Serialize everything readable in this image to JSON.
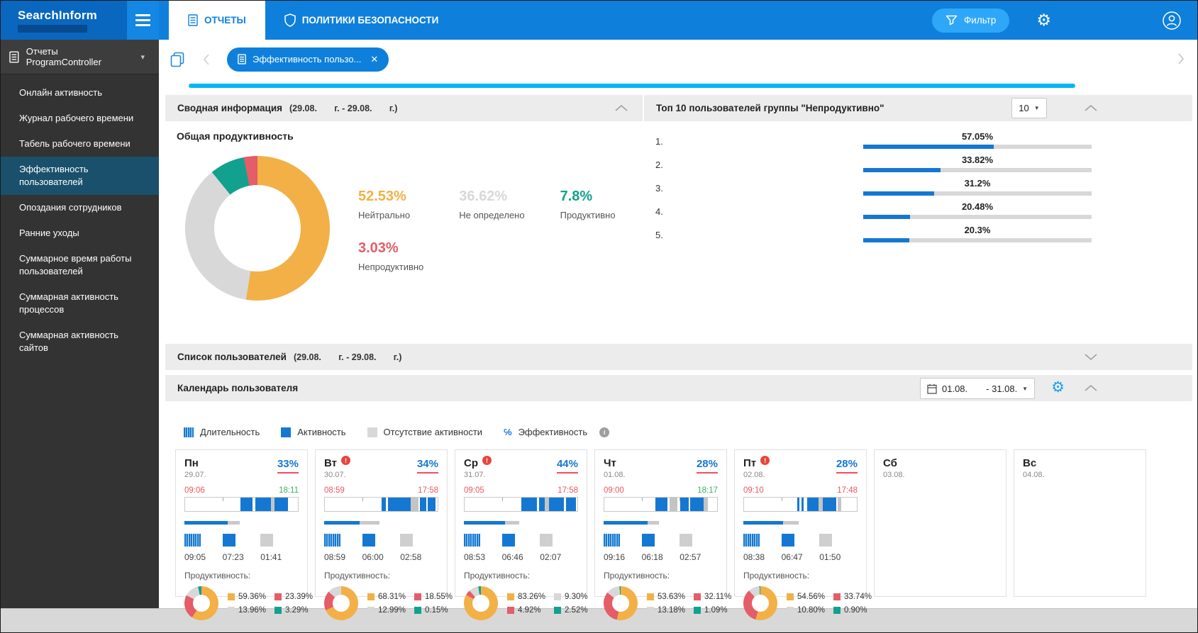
{
  "colors": {
    "orange": "#F2B046",
    "red": "#E45D68",
    "gray": "#D8D8D8",
    "teal": "#13A18F",
    "blue": "#1478D2",
    "accent": "#0E80DB",
    "cyan": "#05B6F5",
    "green": "#3FAE68",
    "time_red": "#EA5860"
  },
  "topbar": {
    "brand": "SearchInform",
    "tabs": [
      {
        "label": "ОТЧЕТЫ",
        "active": true
      },
      {
        "label": "ПОЛИТИКИ БЕЗОПАСНОСТИ",
        "active": false
      }
    ],
    "filter_label": "Фильтр"
  },
  "sidebar": {
    "header_label": "Отчеты ProgramController",
    "items": [
      {
        "label": "Онлайн активность",
        "active": false
      },
      {
        "label": "Журнал рабочего времени",
        "active": false
      },
      {
        "label": "Табель рабочего времени",
        "active": false
      },
      {
        "label": "Эффективность пользователей",
        "active": true
      },
      {
        "label": "Опоздания сотрудников",
        "active": false
      },
      {
        "label": "Ранние уходы",
        "active": false
      },
      {
        "label": "Суммарное время работы пользователей",
        "active": false
      },
      {
        "label": "Суммарная активность процессов",
        "active": false
      },
      {
        "label": "Суммарная активность сайтов",
        "active": false
      }
    ]
  },
  "tabstrip": {
    "chip_label": "Эффективность пользо..."
  },
  "summary": {
    "title": "Сводная информация",
    "period": "(29.08.       г. - 29.08.       г.)",
    "chart_title": "Общая продуктивность",
    "stats": [
      {
        "value": "52.53%",
        "label": "Нейтрально",
        "color": "orange"
      },
      {
        "value": "36.62%",
        "label": "Не определено",
        "color": "gray"
      },
      {
        "value": "7.8%",
        "label": "Продуктивно",
        "color": "teal"
      },
      {
        "value": "3.03%",
        "label": "Непродуктивно",
        "color": "red"
      }
    ]
  },
  "top10": {
    "title": "Топ 10 пользователей группы \"Непродуктивно\"",
    "page_size": "10",
    "rows": [
      {
        "index": "1.",
        "name": "",
        "value": "57.05%",
        "pct": 57.05
      },
      {
        "index": "2.",
        "name": "",
        "value": "33.82%",
        "pct": 33.82
      },
      {
        "index": "3.",
        "name": "",
        "value": "31.2%",
        "pct": 31.2
      },
      {
        "index": "4.",
        "name": "",
        "value": "20.48%",
        "pct": 20.48
      },
      {
        "index": "5.",
        "name": "",
        "value": "20.3%",
        "pct": 20.3
      }
    ]
  },
  "users_list": {
    "title": "Список пользователей",
    "period": "(29.08.       г. - 29.08.       г.)"
  },
  "calendar": {
    "title": "Календарь пользователя",
    "date_from": "01.08.",
    "date_to": "- 31.08.",
    "productivity_label": "Продуктивность:",
    "legend": [
      {
        "label": "Длительность"
      },
      {
        "label": "Активность"
      },
      {
        "label": "Отсутствие активности"
      },
      {
        "label": "Эффективность"
      }
    ],
    "days": [
      {
        "day": "Пн",
        "date": "29.07.",
        "warning": false,
        "efficiency": "33%",
        "time_start": "09:06",
        "time_end": "18:11",
        "end_positive": true,
        "timeline": [
          [
            49,
            11
          ],
          [
            62,
            14
          ],
          [
            76,
            3,
            "g"
          ],
          [
            79,
            12
          ]
        ],
        "duration_fill": 78,
        "stats": [
          {
            "icon": "duration",
            "value": "09:05"
          },
          {
            "icon": "activity",
            "value": "07:23"
          },
          {
            "icon": "absence",
            "value": "01:41"
          }
        ],
        "productivity": [
          {
            "color": "orange",
            "value": "59.36%"
          },
          {
            "color": "red",
            "value": "23.39%"
          },
          {
            "color": "gray",
            "value": "13.96%"
          },
          {
            "color": "teal",
            "value": "3.29%"
          }
        ],
        "donut": [
          [
            "orange",
            59.36
          ],
          [
            "red",
            23.39
          ],
          [
            "gray",
            13.96
          ],
          [
            "teal",
            3.29
          ]
        ]
      },
      {
        "day": "Вт",
        "date": "30.07.",
        "warning": true,
        "efficiency": "34%",
        "time_start": "08:59",
        "time_end": "17:58",
        "end_positive": false,
        "timeline": [
          [
            50,
            4
          ],
          [
            56,
            20
          ],
          [
            76,
            7,
            "g"
          ],
          [
            84,
            6
          ],
          [
            91,
            7
          ]
        ],
        "duration_fill": 64,
        "stats": [
          {
            "icon": "duration",
            "value": "08:59"
          },
          {
            "icon": "activity",
            "value": "06:00"
          },
          {
            "icon": "absence",
            "value": "02:58"
          }
        ],
        "productivity": [
          {
            "color": "orange",
            "value": "68.31%"
          },
          {
            "color": "red",
            "value": "18.55%"
          },
          {
            "color": "gray",
            "value": "12.99%"
          },
          {
            "color": "teal",
            "value": "0.15%"
          }
        ],
        "donut": [
          [
            "orange",
            68.31
          ],
          [
            "red",
            18.55
          ],
          [
            "gray",
            12.99
          ],
          [
            "teal",
            0.15
          ]
        ]
      },
      {
        "day": "Ср",
        "date": "31.07.",
        "warning": true,
        "efficiency": "44%",
        "time_start": "09:05",
        "time_end": "17:58",
        "end_positive": false,
        "timeline": [
          [
            50,
            14
          ],
          [
            66,
            5
          ],
          [
            71,
            4,
            "g"
          ],
          [
            75,
            13
          ],
          [
            90,
            9
          ]
        ],
        "duration_fill": 74,
        "stats": [
          {
            "icon": "duration",
            "value": "08:53"
          },
          {
            "icon": "activity",
            "value": "06:46"
          },
          {
            "icon": "absence",
            "value": "02:07"
          }
        ],
        "productivity": [
          {
            "color": "orange",
            "value": "83.26%"
          },
          {
            "color": "gray",
            "value": "9.30%"
          },
          {
            "color": "red",
            "value": "4.92%"
          },
          {
            "color": "teal",
            "value": "2.52%"
          }
        ],
        "donut": [
          [
            "orange",
            83.26
          ],
          [
            "red",
            4.92
          ],
          [
            "gray",
            9.3
          ],
          [
            "teal",
            2.52
          ]
        ]
      },
      {
        "day": "Чт",
        "date": "01.08.",
        "warning": false,
        "efficiency": "28%",
        "time_start": "09:00",
        "time_end": "18:17",
        "end_positive": true,
        "timeline": [
          [
            45,
            11
          ],
          [
            58,
            7,
            "g"
          ],
          [
            67,
            8
          ],
          [
            76,
            12
          ],
          [
            88,
            4,
            "g"
          ]
        ],
        "duration_fill": 79,
        "stats": [
          {
            "icon": "duration",
            "value": "09:16"
          },
          {
            "icon": "activity",
            "value": "06:18"
          },
          {
            "icon": "absence",
            "value": "02:57"
          }
        ],
        "productivity": [
          {
            "color": "orange",
            "value": "53.63%"
          },
          {
            "color": "red",
            "value": "32.11%"
          },
          {
            "color": "gray",
            "value": "13.18%"
          },
          {
            "color": "teal",
            "value": "1.09%"
          }
        ],
        "donut": [
          [
            "orange",
            53.63
          ],
          [
            "red",
            32.11
          ],
          [
            "gray",
            13.18
          ],
          [
            "teal",
            1.09
          ]
        ]
      },
      {
        "day": "Пт",
        "date": "02.08.",
        "warning": true,
        "efficiency": "28%",
        "time_start": "09:10",
        "time_end": "17:48",
        "end_positive": false,
        "timeline": [
          [
            47,
            2
          ],
          [
            51,
            2
          ],
          [
            56,
            10
          ],
          [
            66,
            4,
            "g"
          ],
          [
            70,
            12
          ],
          [
            83,
            3,
            "g"
          ]
        ],
        "duration_fill": 72,
        "stats": [
          {
            "icon": "duration",
            "value": "08:38"
          },
          {
            "icon": "activity",
            "value": "06:47"
          },
          {
            "icon": "absence",
            "value": "01:50"
          }
        ],
        "productivity": [
          {
            "color": "orange",
            "value": "54.56%"
          },
          {
            "color": "red",
            "value": "33.74%"
          },
          {
            "color": "gray",
            "value": "10.80%"
          },
          {
            "color": "teal",
            "value": "0.90%"
          }
        ],
        "donut": [
          [
            "orange",
            54.56
          ],
          [
            "red",
            33.74
          ],
          [
            "gray",
            10.8
          ],
          [
            "teal",
            0.9
          ]
        ]
      },
      {
        "day": "Сб",
        "date": "03.08."
      },
      {
        "day": "Вс",
        "date": "04.08."
      }
    ]
  },
  "chart_data": [
    {
      "type": "pie",
      "title": "Общая продуктивность",
      "labels": [
        "Нейтрально",
        "Не определено",
        "Продуктивно",
        "Непродуктивно"
      ],
      "values": [
        52.53,
        36.62,
        7.8,
        3.03
      ],
      "colors": [
        "orange",
        "gray",
        "teal",
        "red"
      ],
      "donut": true
    },
    {
      "type": "bar",
      "title": "Топ 10 пользователей группы \"Непродуктивно\"",
      "orientation": "horizontal",
      "categories": [
        "1.",
        "2.",
        "3.",
        "4.",
        "5."
      ],
      "values": [
        57.05,
        33.82,
        31.2,
        20.48,
        20.3
      ],
      "unit": "%",
      "xlim": [
        0,
        100
      ]
    },
    {
      "type": "pie",
      "title": "Продуктивность по дням (Календарь пользователя)",
      "categories": [
        "Пн 29.07.",
        "Вт 30.07.",
        "Ср 31.07.",
        "Чт 01.08.",
        "Пт 02.08."
      ],
      "series": [
        {
          "name": "Нейтрально",
          "values": [
            59.36,
            68.31,
            83.26,
            53.63,
            54.56
          ]
        },
        {
          "name": "Непродуктивно",
          "values": [
            23.39,
            18.55,
            4.92,
            32.11,
            33.74
          ]
        },
        {
          "name": "Не определено",
          "values": [
            13.96,
            12.99,
            9.3,
            13.18,
            10.8
          ]
        },
        {
          "name": "Продуктивно",
          "values": [
            3.29,
            0.15,
            2.52,
            1.09,
            0.9
          ]
        }
      ],
      "efficiency_per_day": [
        33,
        34,
        44,
        28,
        28
      ]
    }
  ]
}
